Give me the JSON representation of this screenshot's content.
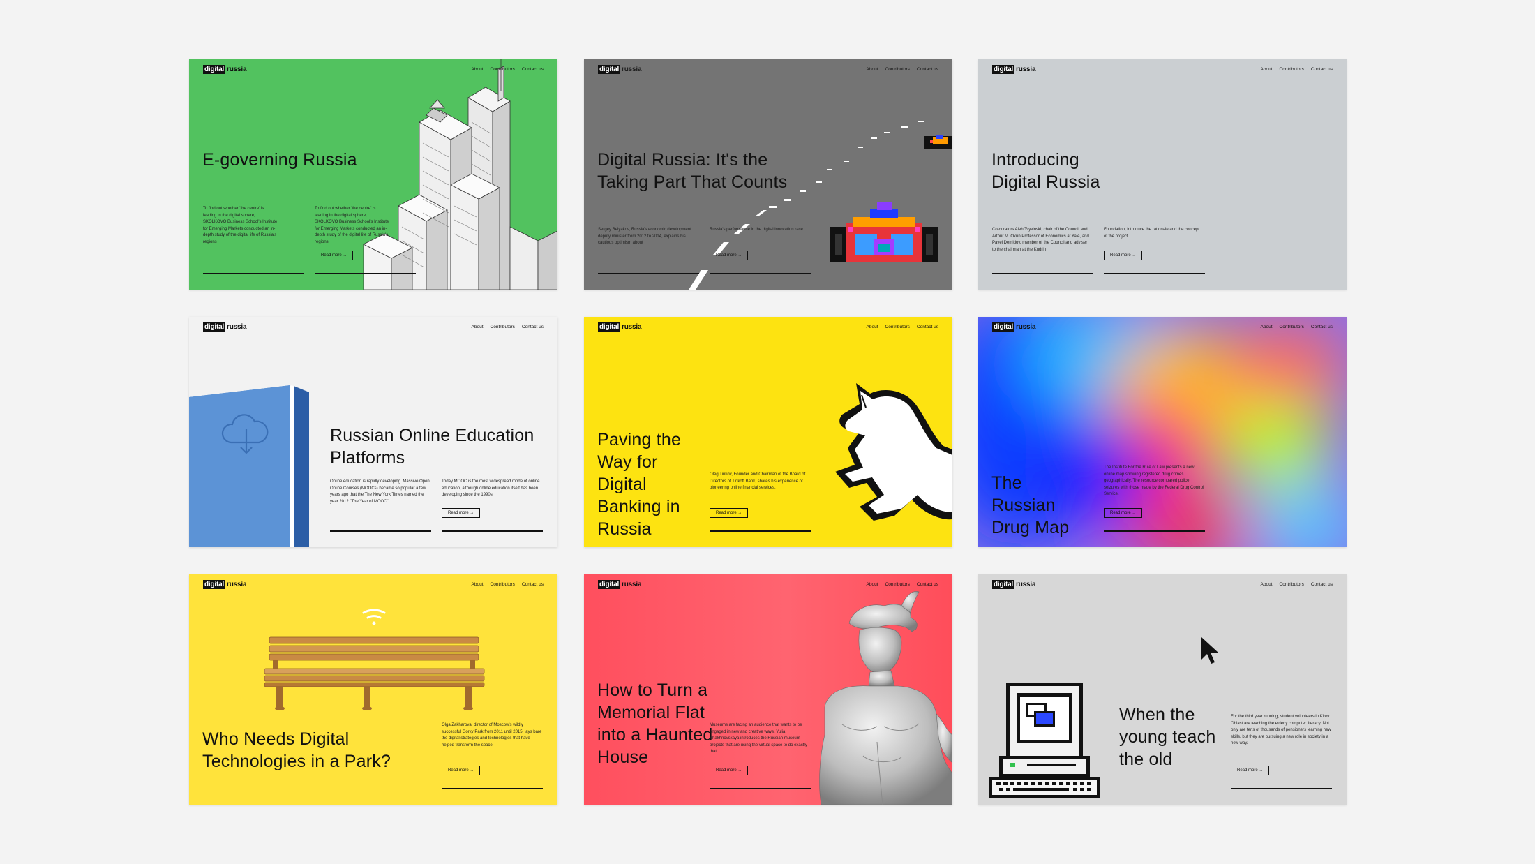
{
  "header": {
    "logo_part1": "digital",
    "logo_part2": "russia",
    "nav_about": "About",
    "nav_contributors": "Contributors",
    "nav_contact": "Contact us"
  },
  "read_more": "Read more →",
  "cards": [
    {
      "title": "E-governing Russia",
      "col1": "To find out whether 'the centre' is leading in the digital sphere, SKOLKOVO Business School's Institute for Emerging Markets conducted an in-depth study of the digital life of Russia's regions",
      "col2": "To find out whether 'the centre' is leading in the digital sphere, SKOLKOVO Business School's Institute for Emerging Markets conducted an in-depth study of the digital life of Russia's regions",
      "colors": {
        "bg": "#52c25f"
      }
    },
    {
      "title": "Digital Russia: It's the Taking Part That Counts",
      "col1": "Sergey Belyakov, Russia's economic development deputy minister from 2012 to 2014, explains his cautious optimism about",
      "col2": "Russia's performance in the digital innovation race.",
      "colors": {
        "bg": "#747474"
      }
    },
    {
      "title": "Introducing Digital Russia",
      "col1": "Co-curators Aleh Tsyvinski, chair of the Council and Arthur M. Okun Professor of Economics at Yale, and Pavel Demidov, member of the Council and adviser to the chairman at the Kudrin",
      "col2": "Foundation, introduce the rationale and the concept of the project.",
      "colors": {
        "bg": "#cbcfd2"
      }
    },
    {
      "title": "Russian Online Education Platforms",
      "col1": "Online education is rapidly developing. Massive Open Online Courses (MOOCs) became so popular a few years ago that the The New York Times named the year 2012 \"The Year of MOOC\"",
      "col2": "Today MOOC is the most widespread mode of online education, although online education itself has been developing since the 1990s.",
      "colors": {
        "bg": "#f2f2f2"
      }
    },
    {
      "title": "Paving the Way for Digital Banking in Russia",
      "col2": "Oleg Tinkov, Founder and Chairman of the Board of Directors of Tinkoff Bank, shares his experience of pioneering online financial services.",
      "colors": {
        "bg": "#fde311"
      }
    },
    {
      "title": "The Russian Drug Map",
      "col2": "The Institute For the Rule of Law presents a new online map showing registered drug crimes geographically. The resource compared police seizures with those made by the Federal Drug Control Service.",
      "colors": {
        "bg": "#ddd"
      }
    },
    {
      "title": "Who Needs Digital Technologies in a Park?",
      "col2": "Olga Zakharova, director of Moscow's wildly successful Gorky Park from 2011 until 2015, lays bare the digital strategies and technologies that have helped transform the space.",
      "colors": {
        "bg": "#ffe33b"
      }
    },
    {
      "title": "How to Turn a Memorial Flat into a Haunted House",
      "col2": "Museums are facing an audience that wants to be engaged in new and creative ways. Yulia Shakhnovskaya introduces the Russian museum projects that are using the virtual space to do exactly that.",
      "colors": {
        "bg": "#ff5663"
      }
    },
    {
      "title": "When the young teach the old",
      "col2": "For the third year running, student volunteers in Kirov Oblast are teaching the elderly computer literacy. Not only are tens of thousands of pensioners learning new skills, but they are pursuing a new role in society in a new way.",
      "colors": {
        "bg": "#d7d7d7"
      }
    }
  ]
}
